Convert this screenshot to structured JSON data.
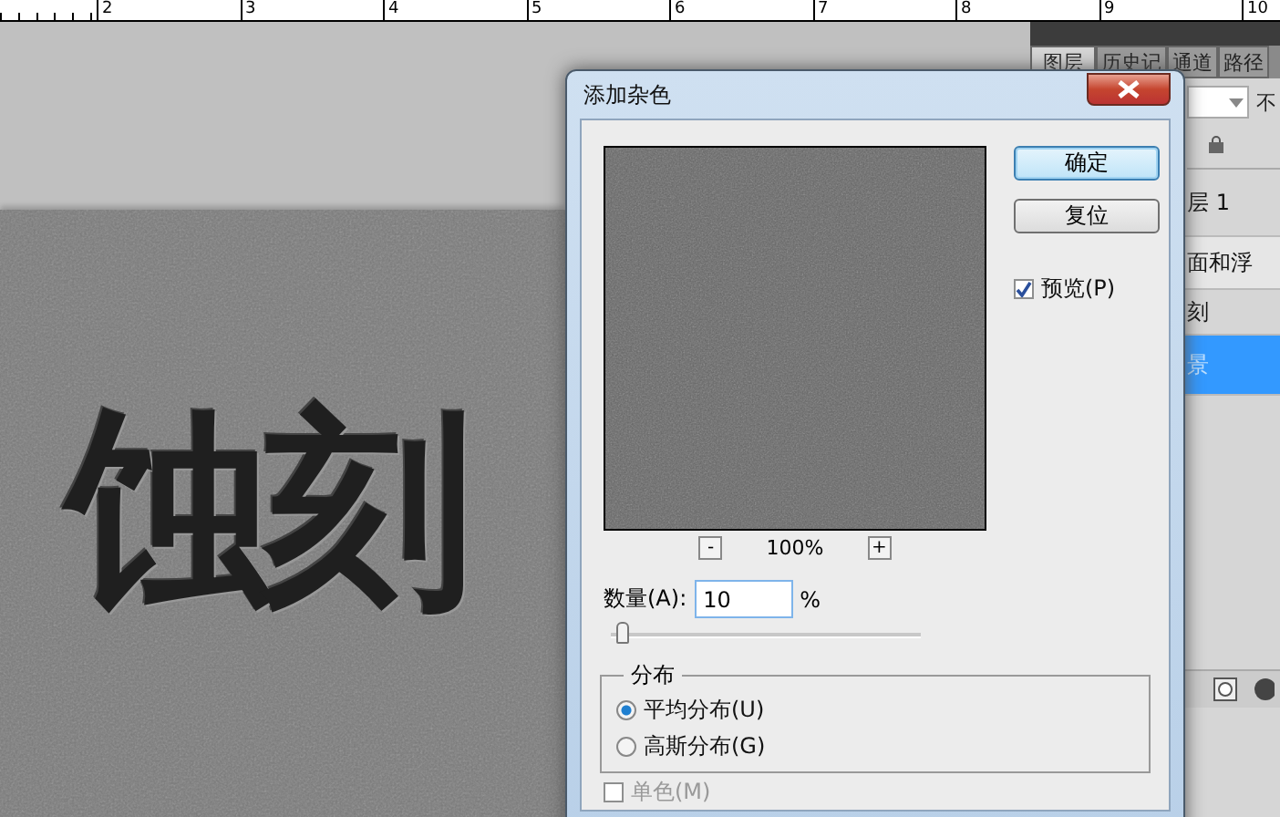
{
  "ruler": {
    "ticks": [
      "2",
      "3",
      "4",
      "5",
      "6",
      "7",
      "8",
      "9",
      "10"
    ]
  },
  "document": {
    "text": "蚀刻"
  },
  "panel": {
    "tabs": [
      {
        "label": "图层",
        "selected": true
      },
      {
        "label": "历史记",
        "selected": false
      },
      {
        "label": "通道",
        "selected": false
      },
      {
        "label": "路径",
        "selected": false
      }
    ],
    "opacity_label": "不",
    "layers": [
      {
        "label": "层 1",
        "selected": false
      },
      {
        "label": "面和浮",
        "selected": false
      },
      {
        "label": "刻",
        "selected": false
      },
      {
        "label": "景",
        "selected": true
      }
    ]
  },
  "dialog": {
    "title": "添加杂色",
    "buttons": [
      {
        "label": "确定",
        "default": true
      },
      {
        "label": "复位",
        "default": false
      }
    ],
    "preview": {
      "label": "预览(P)",
      "checked": true
    },
    "zoom": {
      "minus": "-",
      "value": "100%",
      "plus": "+"
    },
    "amount": {
      "label": "数量(A):",
      "value": "10",
      "unit": "%",
      "level": 0.02
    },
    "distribution": {
      "title": "分布",
      "options": [
        {
          "label": "平均分布(U)",
          "selected": true
        },
        {
          "label": "高斯分布(G)",
          "selected": false
        }
      ]
    },
    "monochrome": {
      "label": "单色(M)",
      "checked": false
    }
  }
}
